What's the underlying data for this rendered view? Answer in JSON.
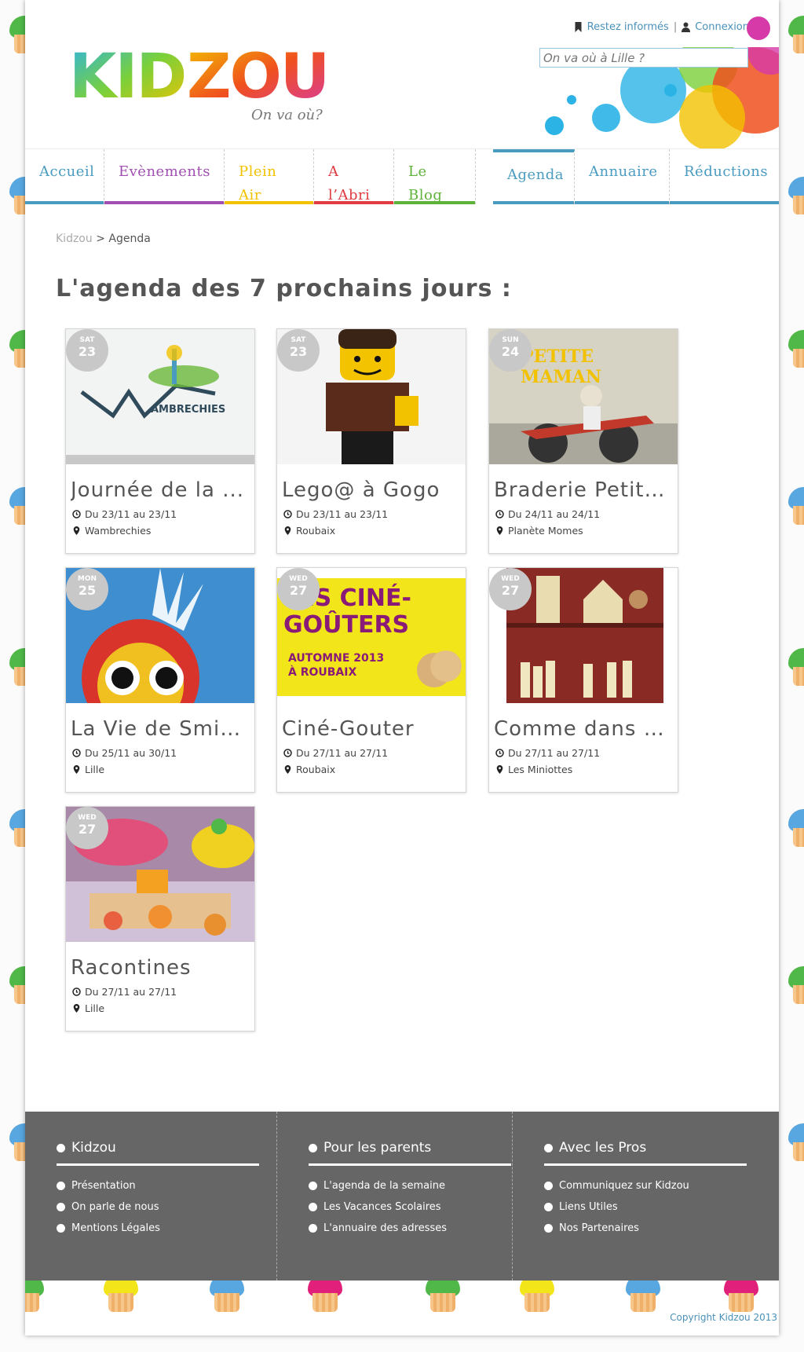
{
  "header": {
    "logo_text": "KIDZOU",
    "logo_tagline": "On va où?",
    "stay_informed": "Restez informés",
    "separator": "|",
    "login": "Connexion",
    "search_placeholder": "On va où à Lille ?"
  },
  "nav": {
    "items": [
      {
        "label": "Accueil",
        "color": "#4a9bc0"
      },
      {
        "label": "Evènements",
        "color": "#a04fb0"
      },
      {
        "label": "Plein Air",
        "color": "#f2c200"
      },
      {
        "label": "A l’Abri",
        "color": "#e03b40"
      },
      {
        "label": "Le Blog",
        "color": "#5fb33a"
      },
      {
        "label": "Agenda",
        "color": "#4a9bc0"
      },
      {
        "label": "Annuaire",
        "color": "#4a9bc0"
      },
      {
        "label": "Réductions",
        "color": "#4a9bc0"
      }
    ]
  },
  "breadcrumb": {
    "home": "Kidzou",
    "sep": ">",
    "current": "Agenda"
  },
  "page_title": "L'agenda des 7 prochains jours :",
  "events": [
    {
      "day_name": "SAT",
      "day_num": "23",
      "title": "Journée de la ...",
      "dates": "Du 23/11 au 23/11",
      "place": "Wambrechies",
      "image_text": "AMBRECHIES"
    },
    {
      "day_name": "SAT",
      "day_num": "23",
      "title": "Lego@ à Gogo",
      "dates": "Du 23/11 au 23/11",
      "place": "Roubaix"
    },
    {
      "day_name": "SUN",
      "day_num": "24",
      "title": "Braderie Petite...",
      "dates": "Du 24/11 au 24/11",
      "place": "Planète Momes",
      "image_text": "PETITE MAMAN"
    },
    {
      "day_name": "MON",
      "day_num": "25",
      "title": "La Vie de Smis...",
      "dates": "Du 25/11 au 30/11",
      "place": "Lille"
    },
    {
      "day_name": "WED",
      "day_num": "27",
      "title": "Ciné-Gouter",
      "dates": "Du 27/11 au 27/11",
      "place": "Roubaix",
      "image_text": "LES CINÉ-GOÛTERS",
      "image_sub": "AUTOMNE 2013 À ROUBAIX"
    },
    {
      "day_name": "WED",
      "day_num": "27",
      "title": "Comme dans u...",
      "dates": "Du 27/11 au 27/11",
      "place": "Les Miniottes"
    },
    {
      "day_name": "WED",
      "day_num": "27",
      "title": "Racontines",
      "dates": "Du 27/11 au 27/11",
      "place": "Lille"
    }
  ],
  "footer": {
    "columns": [
      {
        "title": "Kidzou",
        "links": [
          "Présentation",
          "On parle de nous",
          "Mentions Légales"
        ]
      },
      {
        "title": "Pour les parents",
        "links": [
          "L'agenda de la semaine",
          "Les Vacances Scolaires",
          "L'annuaire des adresses"
        ]
      },
      {
        "title": "Avec les Pros",
        "links": [
          "Communiquez sur Kidzou",
          "Liens Utiles",
          "Nos Partenaires"
        ]
      }
    ],
    "copyright": "Copyright Kidzou 2013"
  }
}
